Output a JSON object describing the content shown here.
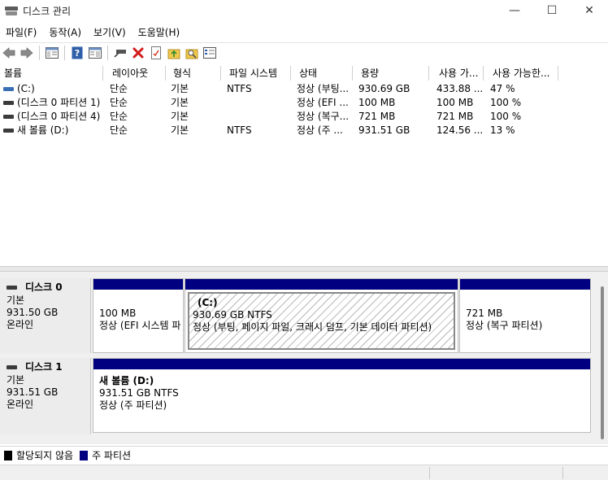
{
  "window": {
    "title": "디스크 관리",
    "minimize_glyph": "—",
    "maximize_glyph": "☐",
    "close_glyph": "✕"
  },
  "menu": [
    "파일(F)",
    "동작(A)",
    "보기(V)",
    "도움말(H)"
  ],
  "toolbar": {
    "icons": [
      "back-arrow-icon",
      "forward-arrow-icon",
      "console-tree-icon",
      "help-icon",
      "action-pane-icon",
      "connect-disk-icon",
      "delete-icon",
      "properties-icon",
      "up-folder-icon",
      "search-folder-icon",
      "settings-icon"
    ]
  },
  "list": {
    "columns": [
      "볼륨",
      "레이아웃",
      "형식",
      "파일 시스템",
      "상태",
      "용량",
      "사용 가...",
      "사용 가능한..."
    ],
    "rows": [
      {
        "volume": "(C:)",
        "layout": "단순",
        "type": "기본",
        "fs": "NTFS",
        "status": "정상 (부팅...",
        "capacity": "930.69 GB",
        "free": "433.88 ...",
        "free_pct": "47 %",
        "icon_color": "#3b6fb5"
      },
      {
        "volume": "(디스크 0 파티션 1)",
        "layout": "단순",
        "type": "기본",
        "fs": "",
        "status": "정상 (EFI ...",
        "capacity": "100 MB",
        "free": "100 MB",
        "free_pct": "100 %",
        "icon_color": "#3b3b3b"
      },
      {
        "volume": "(디스크 0 파티션 4)",
        "layout": "단순",
        "type": "기본",
        "fs": "",
        "status": "정상 (복구...",
        "capacity": "721 MB",
        "free": "721 MB",
        "free_pct": "100 %",
        "icon_color": "#3b3b3b"
      },
      {
        "volume": "새 볼륨 (D:)",
        "layout": "단순",
        "type": "기본",
        "fs": "NTFS",
        "status": "정상 (주 ...",
        "capacity": "931.51 GB",
        "free": "124.56 ...",
        "free_pct": "13 %",
        "icon_color": "#3b3b3b"
      }
    ]
  },
  "disks": [
    {
      "name": "디스크 0",
      "type": "기본",
      "size": "931.50 GB",
      "state": "온라인",
      "partitions": [
        {
          "label": "",
          "size": "100 MB",
          "status": "정상 (EFI 시스템 파"
        },
        {
          "label": "(C:)",
          "size": "930.69 GB NTFS",
          "status": "정상 (부팅, 페이지 파일, 크래시 덤프, 기본 데이터 파티션)"
        },
        {
          "label": "",
          "size": "721 MB",
          "status": "정상 (복구 파티션)"
        }
      ]
    },
    {
      "name": "디스크 1",
      "type": "기본",
      "size": "931.51 GB",
      "state": "온라인",
      "partitions": [
        {
          "label": "새 볼륨  (D:)",
          "size": "931.51 GB NTFS",
          "status": "정상 (주 파티션)"
        }
      ]
    }
  ],
  "legend": [
    {
      "label": "할당되지 않음",
      "color": "#000000"
    },
    {
      "label": "주 파티션",
      "color": "#000080"
    }
  ],
  "colors": {
    "primary_partition_bar": "#000080",
    "unallocated": "#000000",
    "selected_hatch": "#b8b8b8"
  }
}
